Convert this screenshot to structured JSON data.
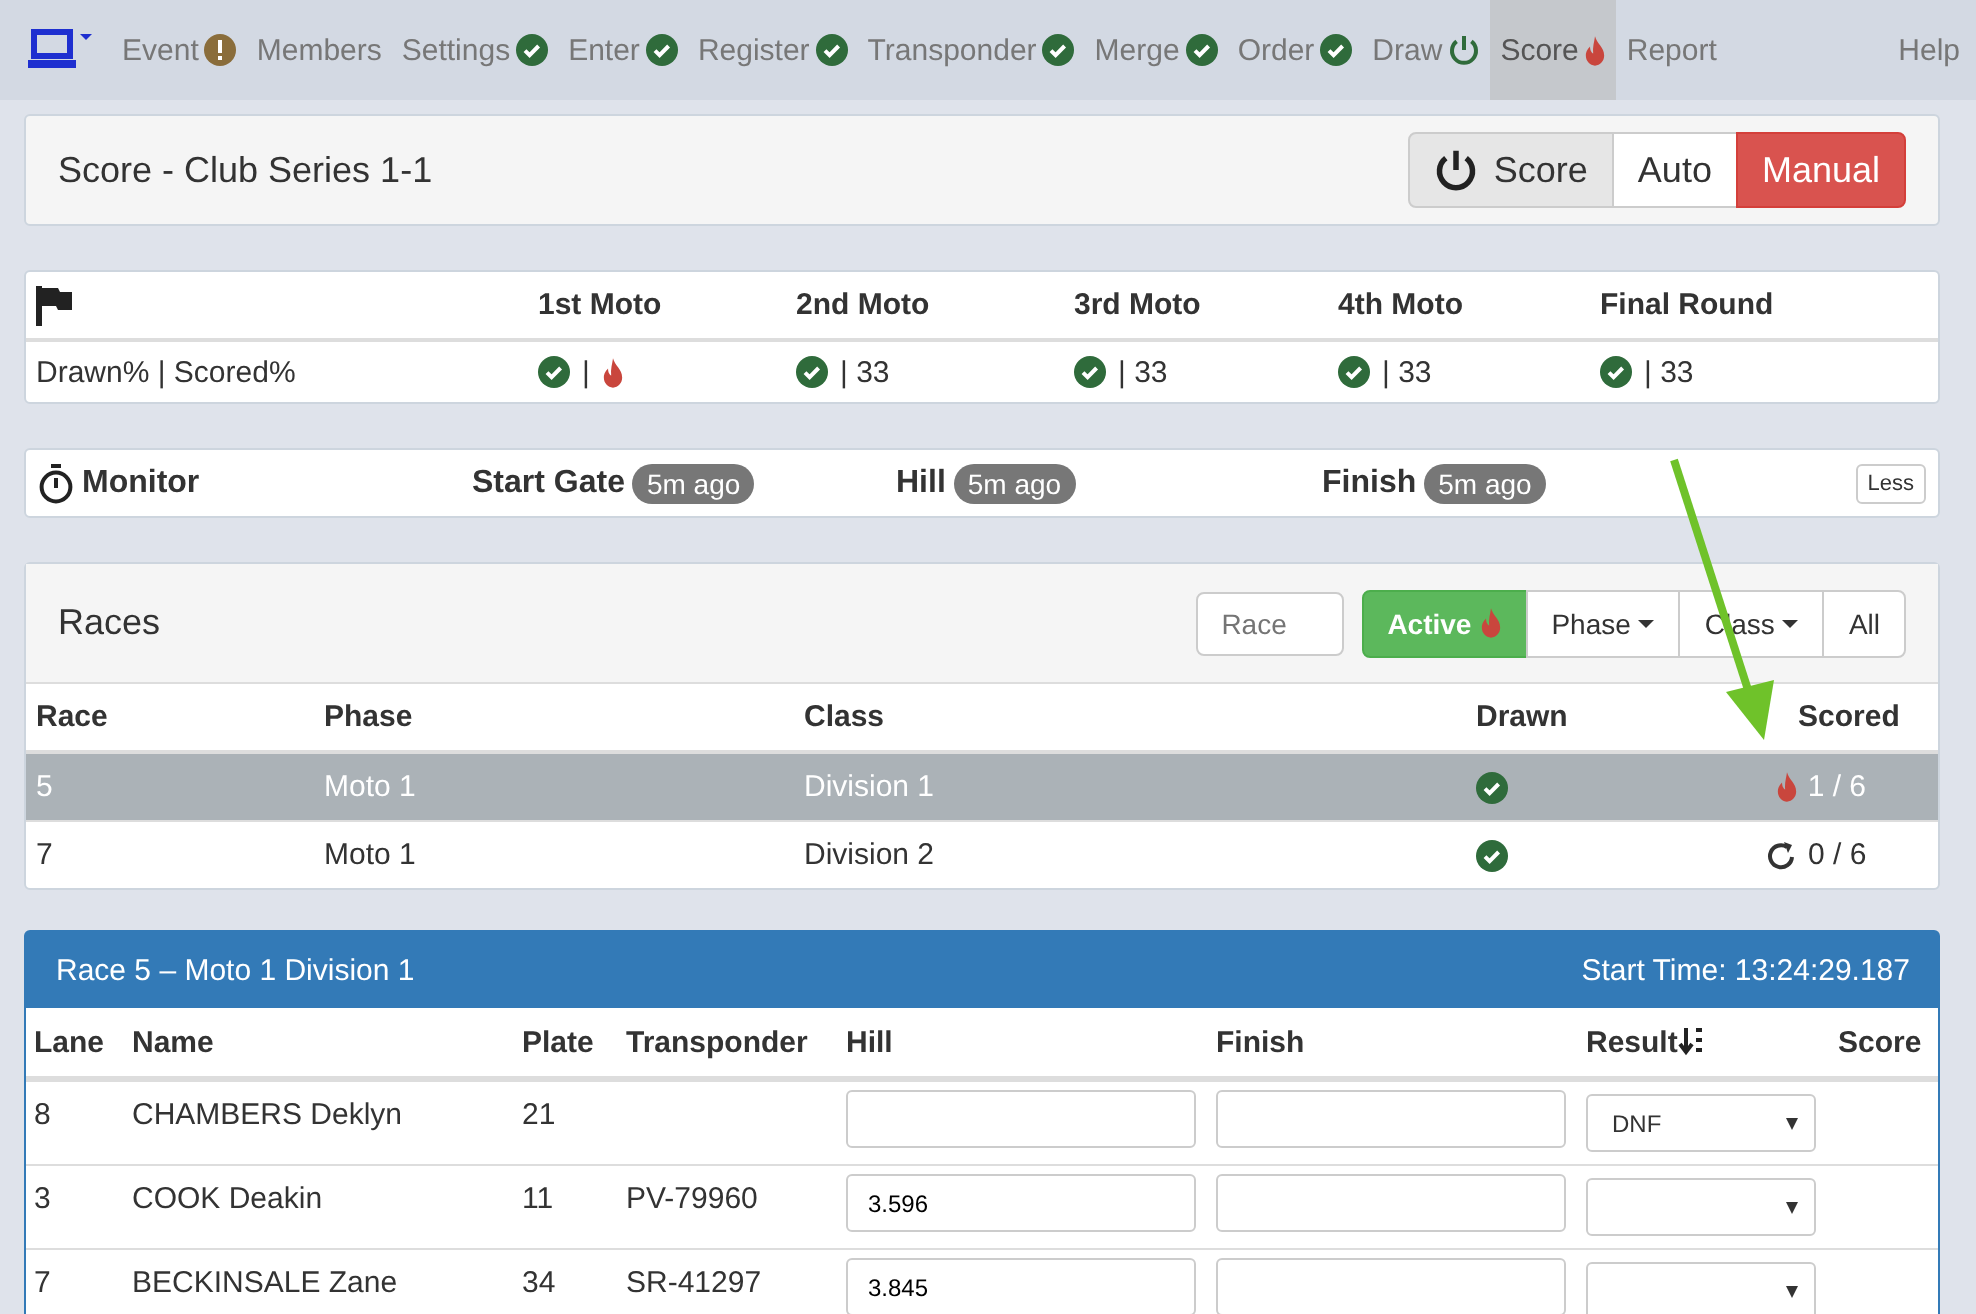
{
  "nav": {
    "items": [
      {
        "label": "Event",
        "kind": "warning",
        "selected": false
      },
      {
        "label": "Members",
        "kind": "plain",
        "selected": false
      },
      {
        "label": "Settings",
        "kind": "check",
        "selected": false
      },
      {
        "label": "Enter",
        "kind": "check",
        "selected": false
      },
      {
        "label": "Register",
        "kind": "check",
        "selected": false
      },
      {
        "label": "Transponder",
        "kind": "check",
        "selected": false
      },
      {
        "label": "Merge",
        "kind": "check",
        "selected": false
      },
      {
        "label": "Order",
        "kind": "check",
        "selected": false
      },
      {
        "label": "Draw",
        "kind": "power",
        "selected": false
      },
      {
        "label": "Score",
        "kind": "fire",
        "selected": true
      },
      {
        "label": "Report",
        "kind": "plain",
        "selected": false
      }
    ],
    "help": "Help"
  },
  "score_panel": {
    "title": "Score - Club Series 1-1",
    "modes": [
      {
        "label": "Score",
        "selected": false,
        "kind": "toggle"
      },
      {
        "label": "Auto",
        "selected": false,
        "kind": "mode"
      },
      {
        "label": "Manual",
        "selected": true,
        "kind": "mode"
      }
    ]
  },
  "moto_table": {
    "columns": [
      "1st Moto",
      "2nd Moto",
      "3rd Moto",
      "4th Moto",
      "Final Round"
    ],
    "row_label": "Drawn% | Scored%",
    "cells": [
      {
        "drawn": true,
        "text": "|",
        "kind": "fire"
      },
      {
        "drawn": true,
        "text": "| 33",
        "kind": "plain"
      },
      {
        "drawn": true,
        "text": "| 33",
        "kind": "plain"
      },
      {
        "drawn": true,
        "text": "| 33",
        "kind": "plain"
      },
      {
        "drawn": true,
        "text": "| 33",
        "kind": "plain"
      }
    ]
  },
  "monitor": {
    "title": "Monitor",
    "points": [
      {
        "label": "Start Gate",
        "badge": "5m ago"
      },
      {
        "label": "Hill",
        "badge": "5m ago"
      },
      {
        "label": "Finish",
        "badge": "5m ago"
      }
    ],
    "less_button": "Less"
  },
  "races": {
    "title": "Races",
    "search": {
      "placeholder": "Race"
    },
    "filters": [
      {
        "label": "Active",
        "kind": "fire",
        "selected": true
      },
      {
        "label": "Phase",
        "kind": "dropdown",
        "selected": false
      },
      {
        "label": "Class",
        "kind": "dropdown",
        "selected": false
      },
      {
        "label": "All",
        "kind": "plain",
        "selected": false
      }
    ],
    "columns": [
      "Race",
      "Phase",
      "Class",
      "Drawn",
      "Scored"
    ],
    "rows": [
      {
        "race": "5",
        "phase": "Moto 1",
        "class": "Division 1",
        "drawn": true,
        "kind": "fire",
        "scored": "1 / 6",
        "selected": true
      },
      {
        "race": "7",
        "phase": "Moto 1",
        "class": "Division 2",
        "drawn": true,
        "kind": "refresh",
        "scored": "0 / 6",
        "selected": false
      }
    ]
  },
  "race_detail": {
    "title": "Race 5 – Moto 1 Division 1",
    "start_time": "Start Time: 13:24:29.187",
    "columns": [
      "Lane",
      "Name",
      "Plate",
      "Transponder",
      "Hill",
      "Finish",
      "Result",
      "Score"
    ],
    "rows": [
      {
        "lane": "8",
        "name": "CHAMBERS Deklyn",
        "plate": "21",
        "result": "DNF"
      },
      {
        "lane": "3",
        "name": "COOK Deakin",
        "plate": "11",
        "transponder": "PV-79960",
        "hill": "3.596"
      },
      {
        "lane": "7",
        "name": "BECKINSALE Zane",
        "plate": "34",
        "transponder": "SR-41297",
        "hill": "3.845"
      }
    ]
  }
}
